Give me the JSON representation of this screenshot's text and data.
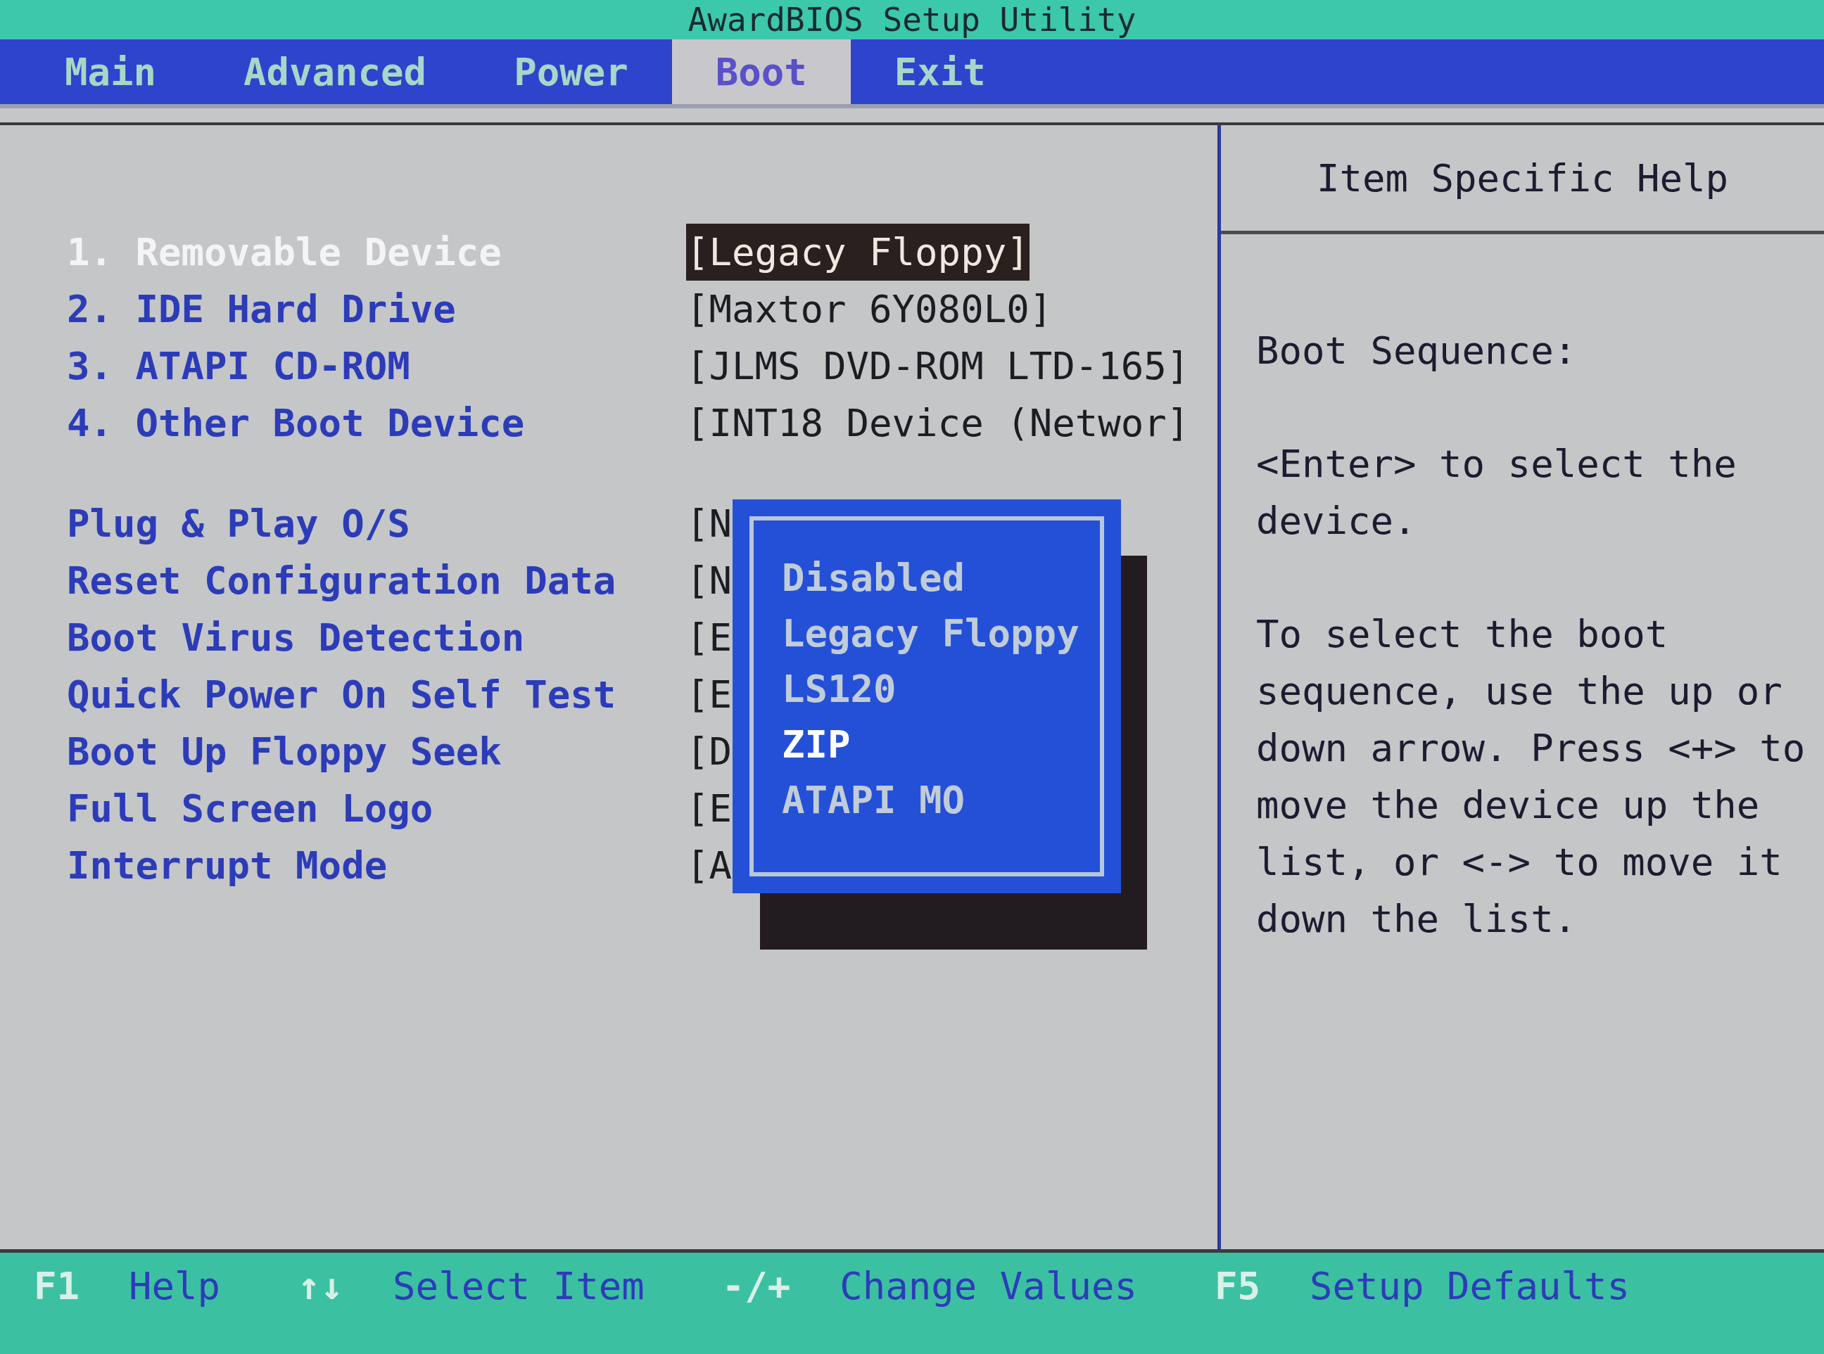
{
  "title": "AwardBIOS Setup Utility",
  "menu": [
    {
      "label": "Main",
      "selected": false
    },
    {
      "label": "Advanced",
      "selected": false
    },
    {
      "label": "Power",
      "selected": false
    },
    {
      "label": "Boot",
      "selected": true
    },
    {
      "label": "Exit",
      "selected": false
    }
  ],
  "setting_groups": [
    [
      {
        "label": "1. Removable Device",
        "value": "[Legacy Floppy]",
        "selected": true
      },
      {
        "label": "2. IDE Hard Drive",
        "value": "[Maxtor 6Y080L0]",
        "selected": false
      },
      {
        "label": "3. ATAPI CD-ROM",
        "value": "[JLMS DVD-ROM LTD-165]",
        "selected": false
      },
      {
        "label": "4. Other Boot Device",
        "value": "[INT18 Device (Networ]",
        "selected": false
      }
    ],
    [
      {
        "label": "Plug & Play O/S",
        "value": "[N",
        "selected": false
      },
      {
        "label": "Reset Configuration Data",
        "value": "[N",
        "selected": false
      },
      {
        "label": "Boot Virus Detection",
        "value": "[E",
        "selected": false
      },
      {
        "label": "Quick Power On Self Test",
        "value": "[E",
        "selected": false
      },
      {
        "label": "Boot Up Floppy Seek",
        "value": "[D",
        "selected": false
      },
      {
        "label": "Full Screen Logo",
        "value": "[E",
        "selected": false
      },
      {
        "label": "Interrupt Mode",
        "value": "[A",
        "selected": false
      }
    ]
  ],
  "popup": {
    "options": [
      {
        "label": "Disabled",
        "selected": false
      },
      {
        "label": "Legacy Floppy",
        "selected": false
      },
      {
        "label": "LS120",
        "selected": false
      },
      {
        "label": "ZIP",
        "selected": true
      },
      {
        "label": "ATAPI MO",
        "selected": false
      }
    ]
  },
  "help": {
    "title": "Item Specific Help",
    "paragraphs": [
      "Boot Sequence:",
      "<Enter> to select the device.",
      "To select the boot sequence, use the up or down arrow. Press <+> to move the device up the list, or <-> to move it down the list."
    ]
  },
  "keys": [
    {
      "key": "F1",
      "action": "Help"
    },
    {
      "key": "↑↓",
      "action": "Select Item"
    },
    {
      "key": "-/+",
      "action": "Change Values"
    },
    {
      "key": "F5",
      "action": "Setup Defaults"
    }
  ]
}
